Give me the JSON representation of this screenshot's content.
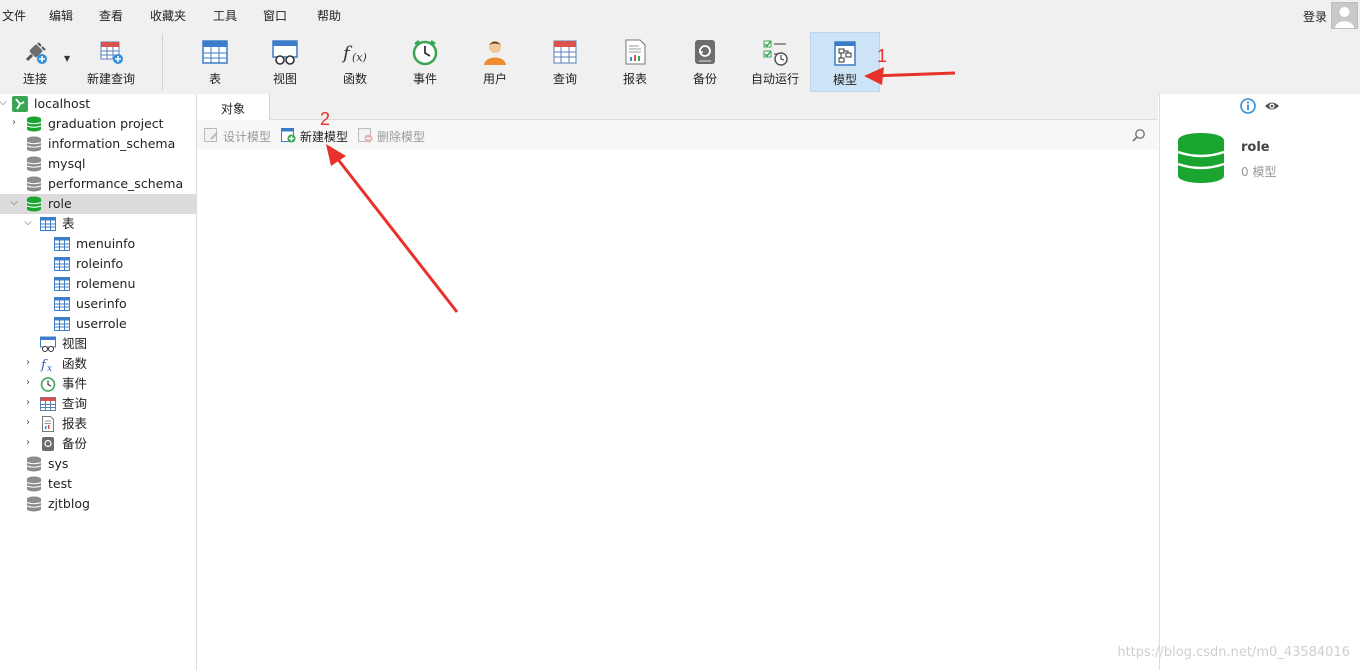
{
  "menu": [
    "文件",
    "编辑",
    "查看",
    "收藏夹",
    "工具",
    "窗口",
    "帮助"
  ],
  "login_label": "登录",
  "toolbar": {
    "connect": "连接",
    "new_query": "新建查询",
    "table": "表",
    "view": "视图",
    "function": "函数",
    "event": "事件",
    "user": "用户",
    "query": "查询",
    "report": "报表",
    "backup": "备份",
    "autorun": "自动运行",
    "model": "模型"
  },
  "tree": {
    "connection": "localhost",
    "databases": [
      "graduation project",
      "information_schema",
      "mysql",
      "performance_schema",
      "role",
      "sys",
      "test",
      "zjtblog"
    ],
    "role_children": {
      "tables_label": "表",
      "tables": [
        "menuinfo",
        "roleinfo",
        "rolemenu",
        "userinfo",
        "userrole"
      ],
      "view": "视图",
      "function": "函数",
      "event": "事件",
      "query": "查询",
      "report": "报表",
      "backup": "备份"
    }
  },
  "tabs": {
    "objects": "对象"
  },
  "obj_toolbar": {
    "design": "设计模型",
    "new": "新建模型",
    "delete": "删除模型"
  },
  "info": {
    "name": "role",
    "count": "0 模型"
  },
  "annotations": {
    "one": "1",
    "two": "2"
  },
  "watermark": "https://blog.csdn.net/m0_43584016",
  "colors": {
    "db_green": "#1aa531",
    "db_gray": "#8c8c8c",
    "selected_bg": "#dcdcdc",
    "active_tool": "#cde4f7",
    "annotation_red": "#e8312a"
  }
}
